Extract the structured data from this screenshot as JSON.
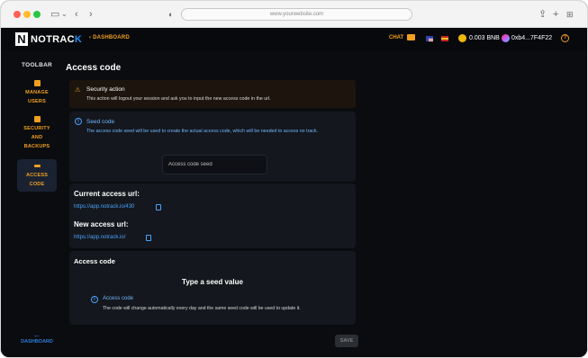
{
  "browser": {
    "url": "www.yourwebsite.com",
    "traffic_colors": [
      "#ff5f57",
      "#febc2e",
      "#28c840"
    ]
  },
  "header": {
    "logo_text_main": "NOTRAC",
    "logo_text_accent": "K",
    "logo_mark": "N",
    "back_label": "DASHBOARD",
    "chat_label": "CHAT",
    "balance": "0.003 BNB",
    "wallet_address": "0xb4...7F4F22"
  },
  "sidebar": {
    "title": "TOOLBAR",
    "items": [
      {
        "label_lines": [
          "MANAGE",
          "USERS"
        ],
        "icon": "user-icon"
      },
      {
        "label_lines": [
          "SECURITY",
          "AND",
          "BACKUPS"
        ],
        "icon": "security-icon"
      },
      {
        "label_lines": [
          "ACCESS",
          "CODE"
        ],
        "icon": "access-code-icon"
      }
    ],
    "bottom_label": "DASHBOARD"
  },
  "main": {
    "title": "Access code",
    "security_alert": {
      "title": "Security action",
      "description": "This action will logout your session and ask you to input the new access code in the url."
    },
    "seed": {
      "title": "Seed code",
      "description": "The access code seed will be used to create the actual access code, which will be needed to access no track.",
      "placeholder": "Access code seed"
    },
    "urls": {
      "current_label": "Current access url:",
      "current_url": "https://app.notrack.io/430",
      "new_label": "New access url:",
      "new_url": "https://app.notrack.io/"
    },
    "access_code": {
      "title": "Access code",
      "prompt": "Type a seed value",
      "info_title": "Access code",
      "info_description": "The code will change automatically every day and the same seed code will be used to update it."
    },
    "save_label": "SAVE"
  },
  "colors": {
    "accent": "#f0a020",
    "link": "#4aa3ff",
    "background": "#0b0c0f",
    "panel": "#14171d"
  }
}
